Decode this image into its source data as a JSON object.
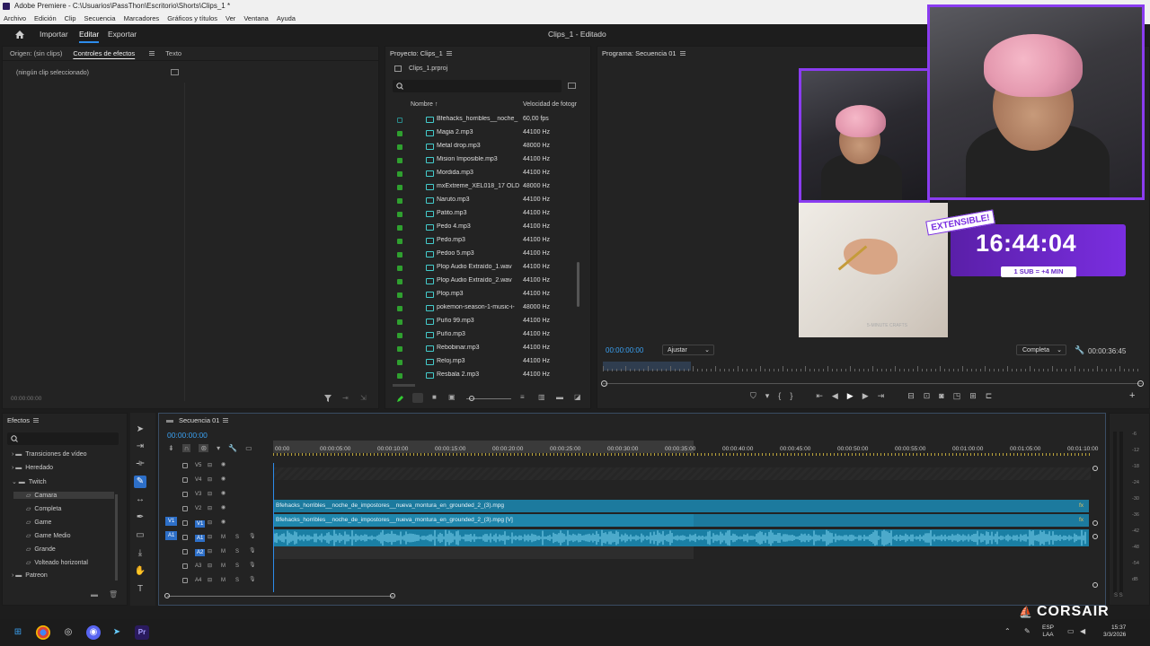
{
  "window": {
    "title": "Adobe Premiere - C:\\Usuarios\\PassThon\\Escritorio\\Shorts\\Clips_1 *",
    "menu": [
      "Archivo",
      "Edición",
      "Clip",
      "Secuencia",
      "Marcadores",
      "Gráficos y títulos",
      "Ver",
      "Ventana",
      "Ayuda"
    ]
  },
  "header": {
    "tabs": [
      "Importar",
      "Editar",
      "Exportar"
    ],
    "active_tab": "Editar",
    "doc_title": "Clips_1 - Editado"
  },
  "source_panel": {
    "tabs": [
      "Origen: (sin clips)",
      "Controles de efectos",
      "Texto"
    ],
    "empty_text": "(ningún clip seleccionado)",
    "timecode": "00:00:00:00"
  },
  "project_panel": {
    "title": "Proyecto: Clips_1",
    "file": "Clips_1.prproj",
    "columns": [
      "Nombre",
      "Velocidad de fotogr"
    ],
    "items": [
      {
        "name": "Bfehacks_horribles__noche_",
        "rate": "60,00 fps"
      },
      {
        "name": "Magia 2.mp3",
        "rate": "44100 Hz"
      },
      {
        "name": "Metal drop.mp3",
        "rate": "48000 Hz"
      },
      {
        "name": "Mision Imposible.mp3",
        "rate": "44100 Hz"
      },
      {
        "name": "Mordida.mp3",
        "rate": "44100 Hz"
      },
      {
        "name": "mxExtreme_XEL018_17 OLD",
        "rate": "48000 Hz"
      },
      {
        "name": "Naruto.mp3",
        "rate": "44100 Hz"
      },
      {
        "name": "Patito.mp3",
        "rate": "44100 Hz"
      },
      {
        "name": "Pedo 4.mp3",
        "rate": "44100 Hz"
      },
      {
        "name": "Pedo.mp3",
        "rate": "44100 Hz"
      },
      {
        "name": "Pedoo 5.mp3",
        "rate": "44100 Hz"
      },
      {
        "name": "Plop Audio Extraído_1.wav",
        "rate": "44100 Hz"
      },
      {
        "name": "Plop Audio Extraído_2.wav",
        "rate": "44100 Hz"
      },
      {
        "name": "Plop.mp3",
        "rate": "44100 Hz"
      },
      {
        "name": "pokemon-season-1-music-i-",
        "rate": "48000 Hz"
      },
      {
        "name": "Puño 99.mp3",
        "rate": "44100 Hz"
      },
      {
        "name": "Puño.mp3",
        "rate": "44100 Hz"
      },
      {
        "name": "Rebobinar.mp3",
        "rate": "44100 Hz"
      },
      {
        "name": "Reloj.mp3",
        "rate": "44100 Hz"
      },
      {
        "name": "Resbala 2.mp3",
        "rate": "44100 Hz"
      }
    ]
  },
  "program_panel": {
    "title": "Programa: Secuencia 01",
    "timecode": "00:00:00:00",
    "fit": "Ajustar",
    "quality": "Completa",
    "duration": "00:00:36:45"
  },
  "overlay": {
    "badge": "EXTENSIBLE!",
    "clock": "16:44:04",
    "sub": "1 SUB = +4 MIN",
    "watermark": "5-MINUTE CRAFTS"
  },
  "effects_panel": {
    "title": "Efectos",
    "items": [
      {
        "label": "Transiciones de vídeo",
        "level": 1,
        "expanded": false
      },
      {
        "label": "Heredado",
        "level": 1,
        "expanded": false
      },
      {
        "label": "Twitch",
        "level": 1,
        "expanded": true
      },
      {
        "label": "Camara",
        "level": 2,
        "selected": true
      },
      {
        "label": "Completa",
        "level": 2
      },
      {
        "label": "Game",
        "level": 2
      },
      {
        "label": "Game Medio",
        "level": 2
      },
      {
        "label": "Grande",
        "level": 2
      },
      {
        "label": "Volteado horizontal",
        "level": 2
      },
      {
        "label": "Patreon",
        "level": 1,
        "expanded": false
      }
    ]
  },
  "timeline": {
    "tab": "Secuencia 01",
    "timecode": "00:00:00:00",
    "ruler": [
      "00:00",
      "00:00:05:00",
      "00:00:10:00",
      "00:00:15:00",
      "00:00:20:00",
      "00:00:25:00",
      "00:00:30:00",
      "00:00:35:00",
      "00:00:40:00",
      "00:00:45:00",
      "00:00:50:00",
      "00:00:55:00",
      "00:01:00:00",
      "00:01:05:00",
      "00:01:10:00"
    ],
    "video_tracks": [
      "V5",
      "V4",
      "V3",
      "V2",
      "V1"
    ],
    "audio_tracks": [
      "A1",
      "A2",
      "A3",
      "A4"
    ],
    "clip_v2": "Bfehacks_horribles__noche_de_impostores__nueva_montura_en_grounded_2_(3).mpg",
    "clip_v1": "Bfehacks_horribles__noche_de_impostores__nueva_montura_en_grounded_2_(3).mpg [V]",
    "fx": "fx",
    "meter_labels": [
      "-6",
      "-12",
      "-18",
      "-24",
      "-30",
      "-36",
      "-42",
      "-48",
      "-54",
      "dB"
    ],
    "meter_footer": "S S"
  },
  "taskbar": {
    "lang": "ESP",
    "lang2": "LAA",
    "time": "15:37",
    "date": "3/3/2026",
    "brand": "CORSAIR"
  }
}
